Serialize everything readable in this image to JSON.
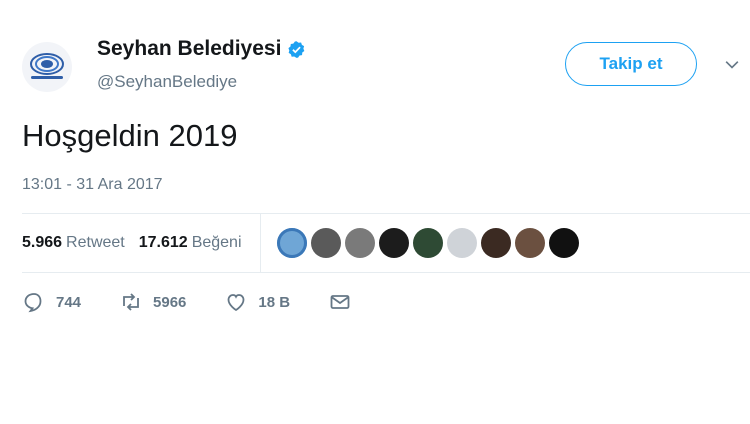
{
  "profile": {
    "display_name": "Seyhan Belediyesi",
    "handle": "@SeyhanBelediye",
    "verified_icon": "verified-badge-icon",
    "avatar_icon": "seyhan-logo-icon"
  },
  "header": {
    "follow_label": "Takip et",
    "menu_icon": "chevron-down-icon"
  },
  "tweet": {
    "text": "Hoşgeldin 2019",
    "timestamp": "13:01 - 31 Ara 2017"
  },
  "stats": {
    "retweets": {
      "count": "5.966",
      "label": "Retweet"
    },
    "likes": {
      "count": "17.612",
      "label": "Beğeni"
    },
    "liker_avatars": [
      {
        "color": "#6fa6d6"
      },
      {
        "color": "#5a5a5a"
      },
      {
        "color": "#7a7a7a"
      },
      {
        "color": "#1c1c1c"
      },
      {
        "color": "#2e4a34"
      },
      {
        "color": "#cfd3d8"
      },
      {
        "color": "#3b2a22"
      },
      {
        "color": "#6b5040"
      },
      {
        "color": "#111111"
      }
    ]
  },
  "actions": {
    "reply": {
      "icon": "reply-icon",
      "count": "744"
    },
    "retweet": {
      "icon": "retweet-icon",
      "count": "5966"
    },
    "like": {
      "icon": "heart-icon",
      "count": "18 B"
    },
    "message": {
      "icon": "envelope-icon"
    }
  },
  "colors": {
    "accent": "#1da1f2",
    "secondary_text": "#657786",
    "divider": "#e6ecf0"
  }
}
